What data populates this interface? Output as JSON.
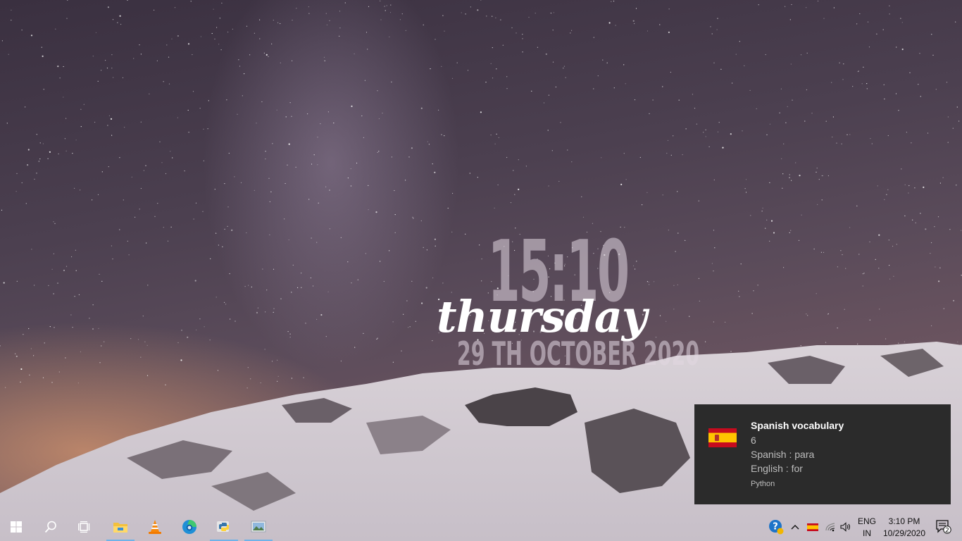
{
  "clock_widget": {
    "time": "15:10",
    "day": "thursday",
    "date": "29 TH OCTOBER 2020"
  },
  "notification": {
    "title": "Spanish vocabulary",
    "count": "6",
    "spanish_line": "Spanish : para",
    "english_line": "English : for",
    "source": "Python",
    "flag_icon": "spain-flag-icon"
  },
  "taskbar": {
    "start_icon": "windows-logo-icon",
    "search_icon": "search-icon",
    "task_view_icon": "task-view-icon",
    "pinned_apps": [
      {
        "name": "file-explorer",
        "icon": "folder-icon",
        "active": true
      },
      {
        "name": "vlc",
        "icon": "vlc-cone-icon",
        "active": false
      },
      {
        "name": "edge",
        "icon": "edge-icon",
        "active": false
      },
      {
        "name": "python",
        "icon": "python-icon",
        "active": true
      },
      {
        "name": "image-viewer",
        "icon": "photo-icon",
        "active": true
      }
    ],
    "tray": {
      "help_icon": "help-icon",
      "chevron_icon": "chevron-up-icon",
      "flag_icon": "spain-flag-icon",
      "network_icon": "wifi-icon",
      "volume_icon": "volume-icon",
      "language_line1": "ENG",
      "language_line2": "IN",
      "time": "3:10 PM",
      "date": "10/29/2020",
      "notification_count": "2"
    }
  },
  "colors": {
    "toast_bg": "#2b2b2b",
    "active_indicator": "#6fb2e8"
  }
}
